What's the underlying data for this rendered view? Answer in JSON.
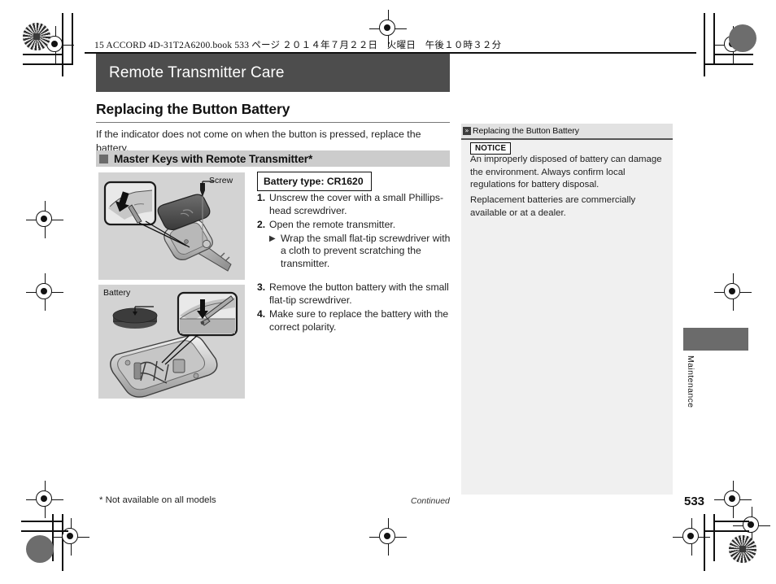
{
  "book_header": "15 ACCORD 4D-31T2A6200.book  533 ページ  ２０１４年７月２２日　火曜日　午後１０時３２分",
  "chapter": {
    "title": "Remote Transmitter Care"
  },
  "section": {
    "heading": "Replacing the Button Battery",
    "intro": "If the indicator does not come on when the button is pressed, replace the battery.",
    "sub_heading": "Master Keys with Remote Transmitter*"
  },
  "figures": {
    "fig1_label": "Screw",
    "fig2_label": "Battery"
  },
  "procedure": {
    "battery_type": "Battery type: CR1620",
    "steps": [
      {
        "num": "1.",
        "text": "Unscrew the cover with a small Phillips-head screwdriver."
      },
      {
        "num": "2.",
        "text": "Open the remote transmitter."
      }
    ],
    "substep": "Wrap the small flat-tip screwdriver with a cloth to prevent scratching the transmitter.",
    "substep_bullet": "▶",
    "steps2": [
      {
        "num": "3.",
        "text": "Remove the button battery with the small flat-tip screwdriver."
      },
      {
        "num": "4.",
        "text": "Make sure to replace the battery with the correct polarity."
      }
    ]
  },
  "sidebar": {
    "icon": "double-chevron-icon",
    "icon_glyph": "»",
    "title": "Replacing the Button Battery",
    "notice_badge": "NOTICE",
    "paragraph1": "An improperly disposed of battery can damage the environment. Always confirm local regulations for battery disposal.",
    "paragraph2": "Replacement batteries are commercially available or at a dealer."
  },
  "side_tab": {
    "label": "Maintenance"
  },
  "footer": {
    "footnote": "* Not available on all models",
    "continued": "Continued",
    "page_number": "533"
  },
  "colors": {
    "title_bar": "#4d4d4d",
    "sub_bar": "#cccccc",
    "sidebar_bg": "#f0f0f0",
    "sidebar_head": "#e2e2e2",
    "figure_bg": "#d3d3d3",
    "side_tab": "#6b6b6b"
  }
}
